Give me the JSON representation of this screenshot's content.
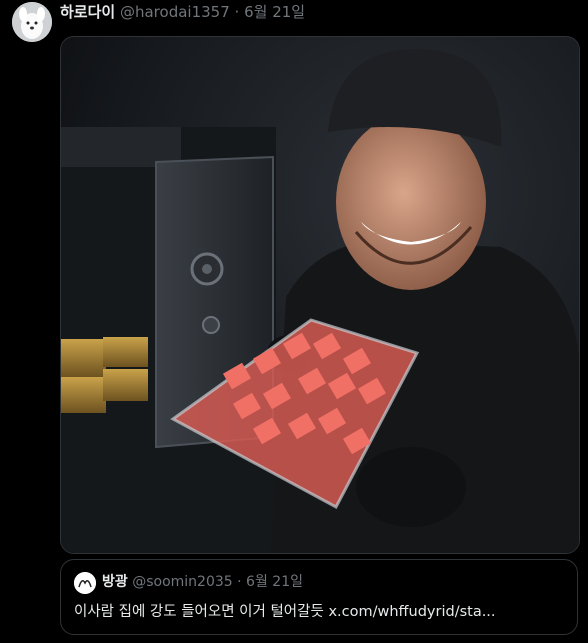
{
  "tweet": {
    "author_name": "하로다이",
    "author_handle": "@harodai1357",
    "separator": "·",
    "date": "6월 21일"
  },
  "quote": {
    "author_name": "방광",
    "author_handle": "@soomin2035",
    "separator": "·",
    "date": "6월 21일",
    "text": "이사람 집에 강도 들어오면 이거 털어갈듯",
    "link": "x.com/whffudyrid/sta..."
  },
  "icons": {
    "avatar": "white-dog-avatar-icon",
    "quote_avatar": "doodle-avatar-icon"
  }
}
